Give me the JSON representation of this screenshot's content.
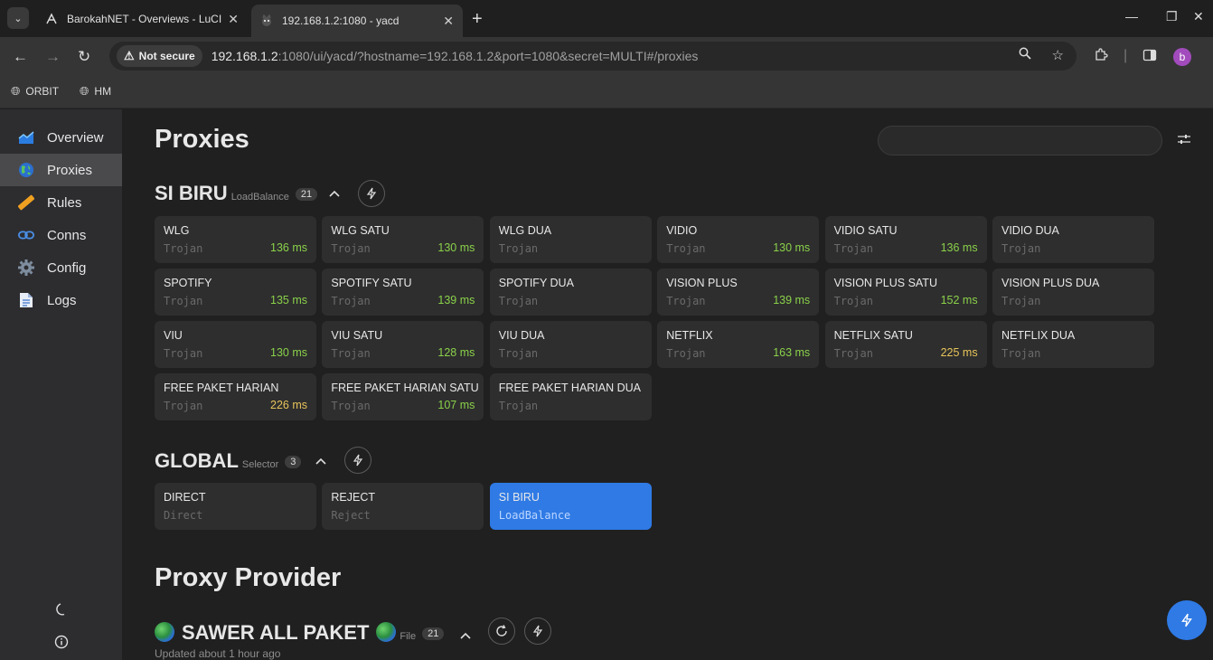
{
  "browser": {
    "tabs": [
      {
        "title": "BarokahNET - Overviews - LuCI",
        "active": false
      },
      {
        "title": "192.168.1.2:1080 - yacd",
        "active": true
      }
    ],
    "security_label": "Not secure",
    "url_host": "192.168.1.2",
    "url_rest": ":1080/ui/yacd/?hostname=192.168.1.2&port=1080&secret=MULTI#/proxies",
    "bookmarks": [
      "ORBIT",
      "HM"
    ],
    "profile_initial": "b"
  },
  "sidebar": {
    "items": [
      {
        "label": "Overview",
        "icon": "chart-icon"
      },
      {
        "label": "Proxies",
        "icon": "globe-icon",
        "active": true
      },
      {
        "label": "Rules",
        "icon": "ruler-icon"
      },
      {
        "label": "Conns",
        "icon": "link-icon"
      },
      {
        "label": "Config",
        "icon": "gear-icon"
      },
      {
        "label": "Logs",
        "icon": "document-icon"
      }
    ]
  },
  "page": {
    "title": "Proxies",
    "provider_title": "Proxy Provider"
  },
  "groups": [
    {
      "name": "SI BIRU",
      "type": "LoadBalance",
      "count": "21",
      "proxies": [
        {
          "name": "WLG",
          "type": "Trojan",
          "latency": "136 ms"
        },
        {
          "name": "WLG SATU",
          "type": "Trojan",
          "latency": "130 ms"
        },
        {
          "name": "WLG DUA",
          "type": "Trojan",
          "latency": ""
        },
        {
          "name": "VIDIO",
          "type": "Trojan",
          "latency": "130 ms"
        },
        {
          "name": "VIDIO SATU",
          "type": "Trojan",
          "latency": "136 ms"
        },
        {
          "name": "VIDIO DUA",
          "type": "Trojan",
          "latency": ""
        },
        {
          "name": "SPOTIFY",
          "type": "Trojan",
          "latency": "135 ms"
        },
        {
          "name": "SPOTIFY SATU",
          "type": "Trojan",
          "latency": "139 ms"
        },
        {
          "name": "SPOTIFY DUA",
          "type": "Trojan",
          "latency": ""
        },
        {
          "name": "VISION PLUS",
          "type": "Trojan",
          "latency": "139 ms"
        },
        {
          "name": "VISION PLUS SATU",
          "type": "Trojan",
          "latency": "152 ms"
        },
        {
          "name": "VISION PLUS DUA",
          "type": "Trojan",
          "latency": ""
        },
        {
          "name": "VIU",
          "type": "Trojan",
          "latency": "130 ms"
        },
        {
          "name": "VIU SATU",
          "type": "Trojan",
          "latency": "128 ms"
        },
        {
          "name": "VIU DUA",
          "type": "Trojan",
          "latency": ""
        },
        {
          "name": "NETFLIX",
          "type": "Trojan",
          "latency": "163 ms"
        },
        {
          "name": "NETFLIX SATU",
          "type": "Trojan",
          "latency": "225 ms"
        },
        {
          "name": "NETFLIX DUA",
          "type": "Trojan",
          "latency": ""
        },
        {
          "name": "FREE PAKET HARIAN",
          "type": "Trojan",
          "latency": "226 ms"
        },
        {
          "name": "FREE PAKET HARIAN SATU",
          "type": "Trojan",
          "latency": "107 ms"
        },
        {
          "name": "FREE PAKET HARIAN DUA",
          "type": "Trojan",
          "latency": ""
        }
      ]
    },
    {
      "name": "GLOBAL",
      "type": "Selector",
      "count": "3",
      "proxies": [
        {
          "name": "DIRECT",
          "type": "Direct",
          "latency": ""
        },
        {
          "name": "REJECT",
          "type": "Reject",
          "latency": ""
        },
        {
          "name": "SI BIRU",
          "type": "LoadBalance",
          "latency": "",
          "selected": true
        }
      ]
    }
  ],
  "provider": {
    "name": "SAWER ALL PAKET",
    "type": "File",
    "count": "21",
    "updated": "Updated about 1 hour ago"
  },
  "colors": {
    "accent": "#2f7ae5",
    "latency_good": "#8ad14a",
    "latency_warn": "#e8c45a"
  }
}
